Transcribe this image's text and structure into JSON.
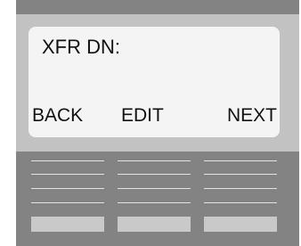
{
  "display": {
    "prompt": "XFR DN:",
    "softkeys": {
      "left": "BACK",
      "middle": "EDIT",
      "right": "NEXT"
    }
  },
  "colors": {
    "device_body": "#838383",
    "bezel": "#c2c2c2",
    "screen": "#f4f4f4",
    "text": "#111111",
    "grille_line": "#e2e2e2",
    "softkey_button": "#c9c9c9"
  }
}
